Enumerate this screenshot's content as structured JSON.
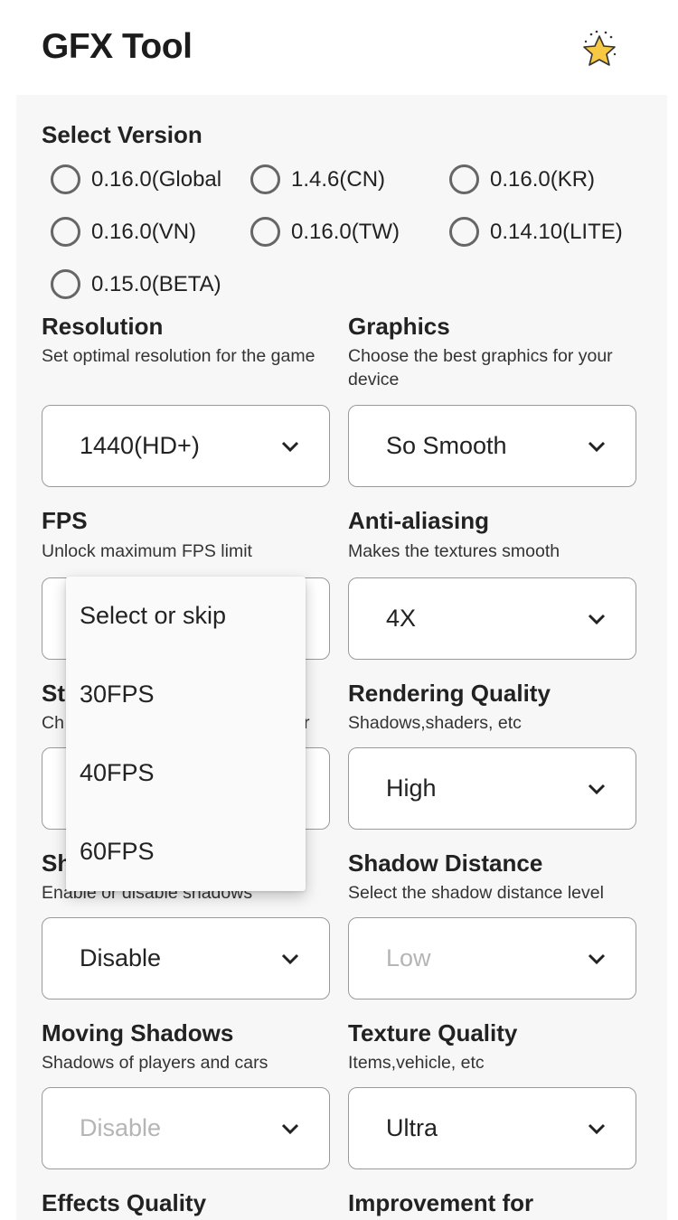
{
  "header": {
    "title": "GFX Tool",
    "rate_icon": "star-icon"
  },
  "version": {
    "label": "Select Version",
    "options": [
      "0.16.0(Global",
      "1.4.6(CN)",
      "0.16.0(KR)",
      "0.16.0(VN)",
      "0.16.0(TW)",
      "0.14.10(LITE)",
      "0.15.0(BETA)"
    ]
  },
  "fields": {
    "resolution": {
      "label": "Resolution",
      "desc": "Set optimal resolution for the game",
      "value": "1440(HD+)"
    },
    "graphics": {
      "label": "Graphics",
      "desc": "Choose the best graphics for your device",
      "value": "So Smooth"
    },
    "fps": {
      "label": "FPS",
      "desc": "Unlock maximum FPS limit"
    },
    "antialiasing": {
      "label": "Anti-aliasing",
      "desc": "Makes the textures smooth",
      "value": "4X"
    },
    "style": {
      "label_visible": "St",
      "desc_visible_start": "Ch",
      "desc_visible_end": "r"
    },
    "rendering": {
      "label": "Rendering Quality",
      "desc": "Shadows,shaders, etc",
      "value": "High"
    },
    "shadows": {
      "label_visible": "Sh",
      "desc": "Enable or disable shadows",
      "value": "Disable"
    },
    "shadow_distance": {
      "label": "Shadow Distance",
      "desc": "Select the shadow distance level",
      "value": "Low"
    },
    "moving_shadows": {
      "label": "Moving Shadows",
      "desc": "Shadows of players and cars",
      "value": "Disable"
    },
    "texture": {
      "label": "Texture Quality",
      "desc": "Items,vehicle, etc",
      "value": "Ultra"
    },
    "effects": {
      "label": "Effects Quality"
    },
    "improvement": {
      "label": "Improvement for"
    }
  },
  "fps_dropdown": {
    "options": [
      "Select or skip",
      "30FPS",
      "40FPS",
      "60FPS"
    ]
  },
  "colors": {
    "panel": "#f7f7f7",
    "border": "#9a9a9a",
    "placeholder": "#b5b5b5"
  }
}
